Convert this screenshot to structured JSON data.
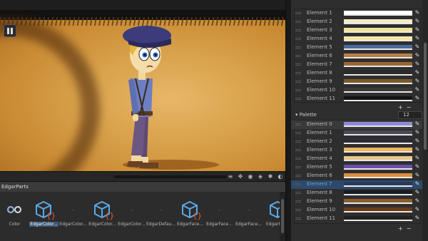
{
  "game": {
    "pause_icon": "pause-icon"
  },
  "project": {
    "title": "EdgarParts",
    "assets": [
      {
        "label": "Color",
        "icon": "link-icon",
        "selected": false
      },
      {
        "label": "EdgarColor...",
        "icon": "script-icon",
        "selected": true
      },
      {
        "label": "EdgarColor...",
        "icon": "dash",
        "selected": false
      },
      {
        "label": "EdgarColor...",
        "icon": "script-icon",
        "selected": false
      },
      {
        "label": "EdgarColor...",
        "icon": "dash",
        "selected": false
      },
      {
        "label": "EdgarDefau...",
        "icon": "dash",
        "selected": false
      },
      {
        "label": "EdgarFace...",
        "icon": "script-icon",
        "selected": false
      },
      {
        "label": "EdgarFace...",
        "icon": "dash",
        "selected": false
      },
      {
        "label": "EdgarFace...",
        "icon": "dash",
        "selected": false
      },
      {
        "label": "EdgarFac...",
        "icon": "script-icon",
        "selected": false
      }
    ]
  },
  "inspector": {
    "top_list": [
      {
        "label": "Element 1",
        "color": "#ffffff"
      },
      {
        "label": "Element 2",
        "color": "#f4ecc8"
      },
      {
        "label": "Element 3",
        "color": "#f2e49a"
      },
      {
        "label": "Element 4",
        "color": "#f6e7a5"
      },
      {
        "label": "Element 5",
        "color": "#4a6a9c"
      },
      {
        "label": "Element 6",
        "color": "#b58048"
      },
      {
        "label": "Element 7",
        "color": "#9a6632"
      },
      {
        "label": "Element 8",
        "color": "#2a2a2a"
      },
      {
        "label": "Element 9",
        "color": "#7a5a28"
      },
      {
        "label": "Element 10",
        "color": "#3a3a3a"
      },
      {
        "label": "Element 11",
        "color": "#141414"
      }
    ],
    "palette_label": "Palette",
    "palette_count": "12",
    "palette_list": [
      {
        "label": "Element 0",
        "color": "#8f8ad6",
        "state": "hover"
      },
      {
        "label": "Element 1",
        "color": "#4b4758"
      },
      {
        "label": "Element 2",
        "color": "#2d2a36"
      },
      {
        "label": "Element 3",
        "color": "#f2b35c"
      },
      {
        "label": "Element 4",
        "color": "#e8c88a"
      },
      {
        "label": "Element 5",
        "color": "#6e4fa8"
      },
      {
        "label": "Element 6",
        "color": "#d98f3e"
      },
      {
        "label": "Element 7",
        "color": "#27395c",
        "state": "active"
      },
      {
        "label": "Element 8",
        "color": "#1a1a22"
      },
      {
        "label": "Element 9",
        "color": "#8a5e2c"
      },
      {
        "label": "Element 10",
        "color": "#6a3c18"
      },
      {
        "label": "Element 11",
        "color": "#222222"
      }
    ]
  }
}
